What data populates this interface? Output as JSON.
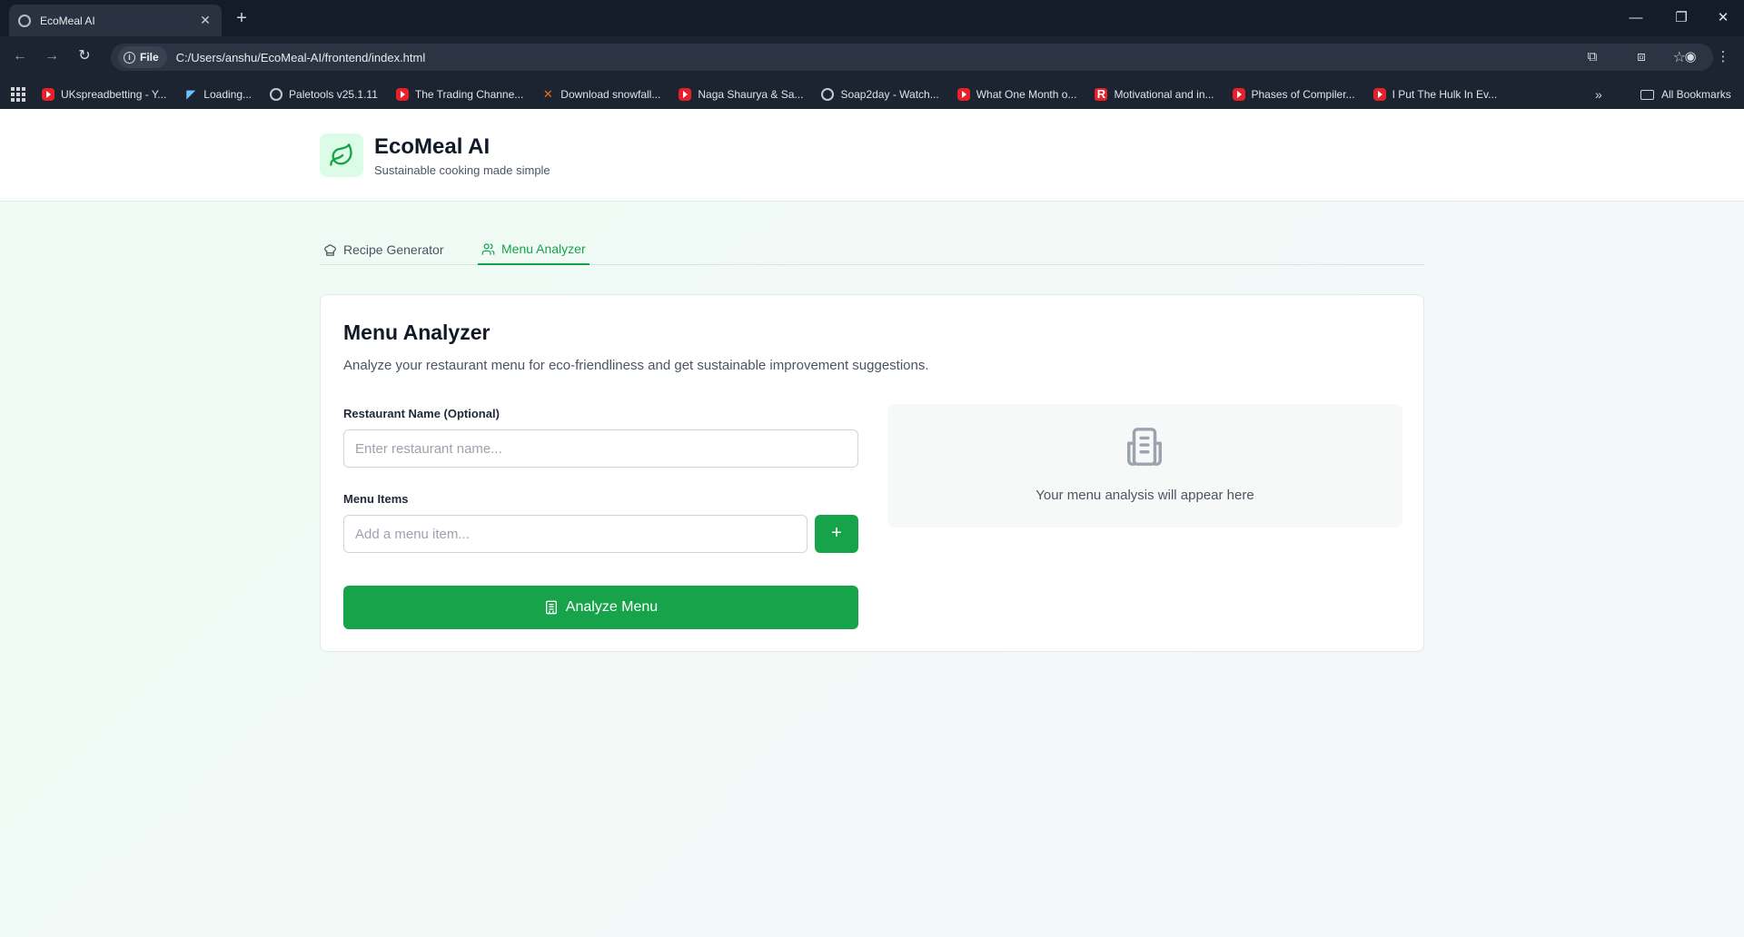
{
  "browser": {
    "tab_title": "EcoMeal AI",
    "tab_close": "✕",
    "new_tab": "+",
    "window_controls": {
      "minimize": "—",
      "restore": "❐",
      "close": "✕"
    },
    "nav": {
      "back": "←",
      "forward": "→",
      "reload": "↻"
    },
    "address": {
      "scheme_chip": "File",
      "info_glyph": "i",
      "url": "C:/Users/anshu/EcoMeal-AI/frontend/index.html"
    },
    "toolbar_icons": {
      "star": "☆",
      "extensions": "⧉",
      "cast": "⧈",
      "profile": "◉",
      "menu": "⋮"
    },
    "bookmarks": [
      {
        "label": "UKspreadbetting - Y...",
        "icon": "youtube-icon"
      },
      {
        "label": "Loading...",
        "icon": "site-icon"
      },
      {
        "label": "Paletools v25.1.11",
        "icon": "globe-icon"
      },
      {
        "label": "The Trading Channe...",
        "icon": "youtube-icon"
      },
      {
        "label": "Download snowfall...",
        "icon": "x-site-icon"
      },
      {
        "label": "Naga Shaurya & Sa...",
        "icon": "youtube-icon"
      },
      {
        "label": "Soap2day - Watch...",
        "icon": "globe-icon"
      },
      {
        "label": "What One Month o...",
        "icon": "youtube-icon"
      },
      {
        "label": "Motivational and in...",
        "icon": "r-site-icon"
      },
      {
        "label": "Phases of Compiler...",
        "icon": "youtube-icon"
      },
      {
        "label": "I Put The Hulk In Ev...",
        "icon": "youtube-icon"
      }
    ],
    "bookmarks_more": "»",
    "all_bookmarks": "All Bookmarks"
  },
  "header": {
    "title": "EcoMeal AI",
    "subtitle": "Sustainable cooking made simple"
  },
  "tabs": [
    {
      "label": "Recipe Generator",
      "active": false
    },
    {
      "label": "Menu Analyzer",
      "active": true
    }
  ],
  "menu_analyzer": {
    "title": "Menu Analyzer",
    "description": "Analyze your restaurant menu for eco-friendliness and get sustainable improvement suggestions.",
    "restaurant_label": "Restaurant Name (Optional)",
    "restaurant_placeholder": "Enter restaurant name...",
    "restaurant_value": "",
    "menu_items_label": "Menu Items",
    "menu_item_placeholder": "Add a menu item...",
    "menu_item_value": "",
    "add_button": "+",
    "analyze_button": "Analyze Menu",
    "result_placeholder": "Your menu analysis will appear here"
  },
  "colors": {
    "accent": "#16a34a",
    "accent_light": "#dcfce7",
    "chrome_bg": "#1c2331"
  }
}
